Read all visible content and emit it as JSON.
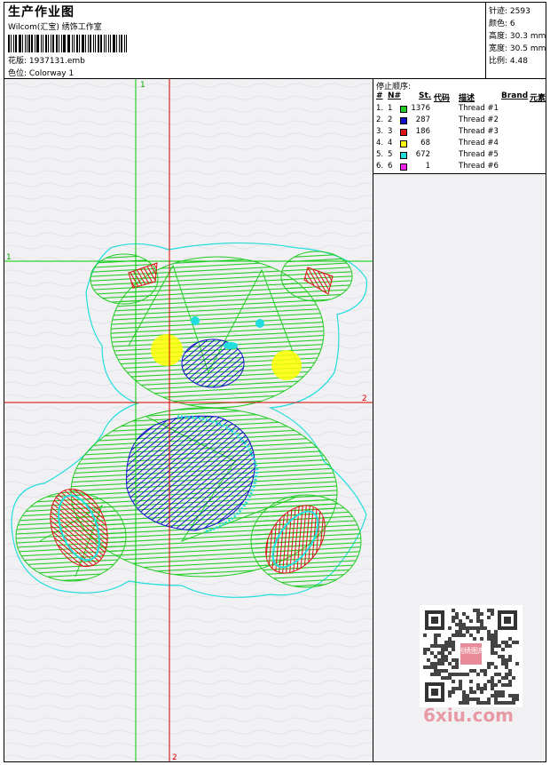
{
  "header": {
    "title": "生产作业图",
    "studio": "Wilcom(汇宝) 绣饰工作室",
    "design_label": "花版:",
    "design_file": "1937131.emb",
    "colorway_label": "色位:",
    "colorway": "Colorway 1"
  },
  "stats": [
    {
      "label": "针迹:",
      "value": "2593"
    },
    {
      "label": "颜色:",
      "value": "6"
    },
    {
      "label": "高度:",
      "value": "30.3 mm"
    },
    {
      "label": "宽度:",
      "value": "30.5 mm"
    },
    {
      "label": "比例:",
      "value": "4.48"
    }
  ],
  "stop_sequence": {
    "title": "停止顺序:",
    "headers": {
      "num": "#",
      "n": "N#",
      "st": "St.",
      "code": "代码",
      "desc": "描述",
      "brand": "Brand",
      "element": "元素"
    },
    "rows": [
      {
        "num": "1.",
        "n": "1",
        "color": "#22cc22",
        "stitches": "1376",
        "desc": "Thread #1"
      },
      {
        "num": "2.",
        "n": "2",
        "color": "#1111cc",
        "stitches": "287",
        "desc": "Thread #2"
      },
      {
        "num": "3.",
        "n": "3",
        "color": "#dd1111",
        "stitches": "186",
        "desc": "Thread #3"
      },
      {
        "num": "4.",
        "n": "4",
        "color": "#ffff00",
        "stitches": "68",
        "desc": "Thread #4"
      },
      {
        "num": "5.",
        "n": "5",
        "color": "#22dddd",
        "stitches": "672",
        "desc": "Thread #5"
      },
      {
        "num": "6.",
        "n": "6",
        "color": "#ee22ee",
        "stitches": "1",
        "desc": "Thread #6"
      }
    ]
  },
  "crosshair": {
    "v1": "1",
    "h1": "1",
    "v2": "2",
    "h2": "2"
  },
  "watermark": "6xiu.com",
  "qr_badge": "刺绣图库"
}
